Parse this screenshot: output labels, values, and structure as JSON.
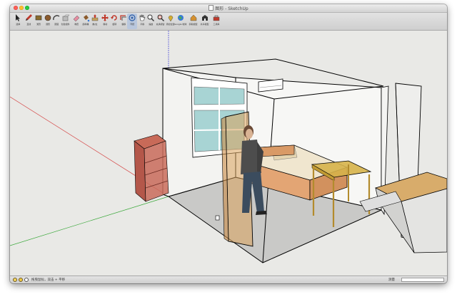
{
  "window": {
    "title": "图形 - SketchUp"
  },
  "toolbar": {
    "tools": [
      {
        "name": "select-tool",
        "label": "选择",
        "icon": "cursor-arrow-icon",
        "active": false
      },
      {
        "name": "line-tool",
        "label": "直线",
        "icon": "pencil-icon",
        "active": false
      },
      {
        "name": "rectangle-tool",
        "label": "矩形",
        "icon": "rectangle-icon",
        "active": false
      },
      {
        "name": "circle-tool",
        "label": "圆形",
        "icon": "circle-icon",
        "active": false
      },
      {
        "name": "arc-tool",
        "label": "圆弧",
        "icon": "arc-icon",
        "active": false
      },
      {
        "name": "make-component-tool",
        "label": "创建组件",
        "icon": "component-icon",
        "active": false
      },
      {
        "name": "eraser-tool",
        "label": "橡皮",
        "icon": "eraser-icon",
        "active": false
      },
      {
        "name": "paint-bucket-tool",
        "label": "颜料桶",
        "icon": "paint-bucket-icon",
        "active": false
      },
      {
        "name": "push-pull-tool",
        "label": "推/拉",
        "icon": "push-pull-icon",
        "active": false
      },
      {
        "name": "move-tool",
        "label": "移动",
        "icon": "move-icon",
        "active": false
      },
      {
        "name": "rotate-tool",
        "label": "旋转",
        "icon": "rotate-icon",
        "active": false
      },
      {
        "name": "offset-tool",
        "label": "偏移",
        "icon": "offset-icon",
        "active": false
      },
      {
        "name": "orbit-tool",
        "label": "环绕",
        "icon": "orbit-icon",
        "active": true
      },
      {
        "name": "pan-tool",
        "label": "平移",
        "icon": "hand-icon",
        "active": false
      },
      {
        "name": "zoom-tool",
        "label": "缩放",
        "icon": "magnifier-icon",
        "active": false
      },
      {
        "name": "zoom-extents-tool",
        "label": "充满视窗",
        "icon": "zoom-extents-icon",
        "active": false
      },
      {
        "name": "add-location-tool",
        "label": "添加位置",
        "icon": "location-pin-icon",
        "active": false
      },
      {
        "name": "google-earth-tool",
        "label": "Google 地球",
        "icon": "earth-icon",
        "active": false
      },
      {
        "name": "get-models-tool",
        "label": "获取模型",
        "icon": "warehouse-icon",
        "active": false
      },
      {
        "name": "share-model-tool",
        "label": "共享模型",
        "icon": "share-icon",
        "active": false
      },
      {
        "name": "extension-tool",
        "label": "工具库",
        "icon": "toolbox-icon",
        "active": false
      }
    ]
  },
  "statusbar": {
    "hint": "拖曳鼠标，双击 + 平移",
    "measure_label": "测量",
    "measure_value": ""
  },
  "colors": {
    "viewport_bg": "#e9e9e6",
    "wall": "#f2f2f0",
    "floor": "#c9c9c7",
    "bed_wood": "#e0a070",
    "bed_mattress": "#efe3c8",
    "door": "#d9a05a",
    "table": "#d6b24a",
    "shelf": "#b55a4a",
    "window_glass": "#a8d4d4",
    "axis_red": "#d43a3a",
    "axis_green": "#3aa83a",
    "axis_blue": "#3a3ad4"
  }
}
